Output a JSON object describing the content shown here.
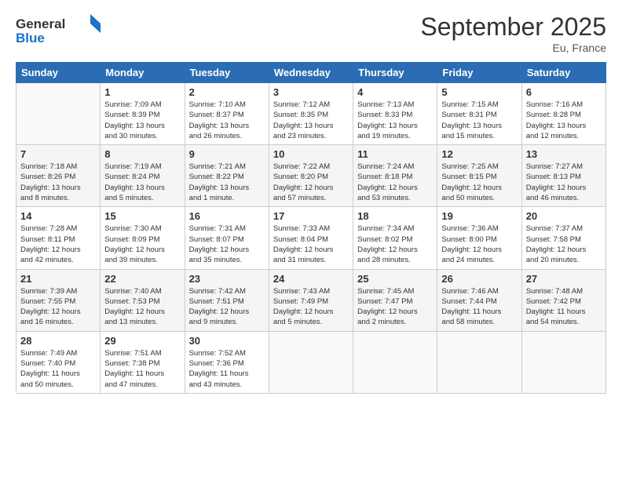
{
  "logo": {
    "general": "General",
    "blue": "Blue"
  },
  "header": {
    "month": "September 2025",
    "location": "Eu, France"
  },
  "weekdays": [
    "Sunday",
    "Monday",
    "Tuesday",
    "Wednesday",
    "Thursday",
    "Friday",
    "Saturday"
  ],
  "weeks": [
    [
      {
        "day": "",
        "info": ""
      },
      {
        "day": "1",
        "info": "Sunrise: 7:09 AM\nSunset: 8:39 PM\nDaylight: 13 hours\nand 30 minutes."
      },
      {
        "day": "2",
        "info": "Sunrise: 7:10 AM\nSunset: 8:37 PM\nDaylight: 13 hours\nand 26 minutes."
      },
      {
        "day": "3",
        "info": "Sunrise: 7:12 AM\nSunset: 8:35 PM\nDaylight: 13 hours\nand 23 minutes."
      },
      {
        "day": "4",
        "info": "Sunrise: 7:13 AM\nSunset: 8:33 PM\nDaylight: 13 hours\nand 19 minutes."
      },
      {
        "day": "5",
        "info": "Sunrise: 7:15 AM\nSunset: 8:31 PM\nDaylight: 13 hours\nand 15 minutes."
      },
      {
        "day": "6",
        "info": "Sunrise: 7:16 AM\nSunset: 8:28 PM\nDaylight: 13 hours\nand 12 minutes."
      }
    ],
    [
      {
        "day": "7",
        "info": "Sunrise: 7:18 AM\nSunset: 8:26 PM\nDaylight: 13 hours\nand 8 minutes."
      },
      {
        "day": "8",
        "info": "Sunrise: 7:19 AM\nSunset: 8:24 PM\nDaylight: 13 hours\nand 5 minutes."
      },
      {
        "day": "9",
        "info": "Sunrise: 7:21 AM\nSunset: 8:22 PM\nDaylight: 13 hours\nand 1 minute."
      },
      {
        "day": "10",
        "info": "Sunrise: 7:22 AM\nSunset: 8:20 PM\nDaylight: 12 hours\nand 57 minutes."
      },
      {
        "day": "11",
        "info": "Sunrise: 7:24 AM\nSunset: 8:18 PM\nDaylight: 12 hours\nand 53 minutes."
      },
      {
        "day": "12",
        "info": "Sunrise: 7:25 AM\nSunset: 8:15 PM\nDaylight: 12 hours\nand 50 minutes."
      },
      {
        "day": "13",
        "info": "Sunrise: 7:27 AM\nSunset: 8:13 PM\nDaylight: 12 hours\nand 46 minutes."
      }
    ],
    [
      {
        "day": "14",
        "info": "Sunrise: 7:28 AM\nSunset: 8:11 PM\nDaylight: 12 hours\nand 42 minutes."
      },
      {
        "day": "15",
        "info": "Sunrise: 7:30 AM\nSunset: 8:09 PM\nDaylight: 12 hours\nand 39 minutes."
      },
      {
        "day": "16",
        "info": "Sunrise: 7:31 AM\nSunset: 8:07 PM\nDaylight: 12 hours\nand 35 minutes."
      },
      {
        "day": "17",
        "info": "Sunrise: 7:33 AM\nSunset: 8:04 PM\nDaylight: 12 hours\nand 31 minutes."
      },
      {
        "day": "18",
        "info": "Sunrise: 7:34 AM\nSunset: 8:02 PM\nDaylight: 12 hours\nand 28 minutes."
      },
      {
        "day": "19",
        "info": "Sunrise: 7:36 AM\nSunset: 8:00 PM\nDaylight: 12 hours\nand 24 minutes."
      },
      {
        "day": "20",
        "info": "Sunrise: 7:37 AM\nSunset: 7:58 PM\nDaylight: 12 hours\nand 20 minutes."
      }
    ],
    [
      {
        "day": "21",
        "info": "Sunrise: 7:39 AM\nSunset: 7:55 PM\nDaylight: 12 hours\nand 16 minutes."
      },
      {
        "day": "22",
        "info": "Sunrise: 7:40 AM\nSunset: 7:53 PM\nDaylight: 12 hours\nand 13 minutes."
      },
      {
        "day": "23",
        "info": "Sunrise: 7:42 AM\nSunset: 7:51 PM\nDaylight: 12 hours\nand 9 minutes."
      },
      {
        "day": "24",
        "info": "Sunrise: 7:43 AM\nSunset: 7:49 PM\nDaylight: 12 hours\nand 5 minutes."
      },
      {
        "day": "25",
        "info": "Sunrise: 7:45 AM\nSunset: 7:47 PM\nDaylight: 12 hours\nand 2 minutes."
      },
      {
        "day": "26",
        "info": "Sunrise: 7:46 AM\nSunset: 7:44 PM\nDaylight: 11 hours\nand 58 minutes."
      },
      {
        "day": "27",
        "info": "Sunrise: 7:48 AM\nSunset: 7:42 PM\nDaylight: 11 hours\nand 54 minutes."
      }
    ],
    [
      {
        "day": "28",
        "info": "Sunrise: 7:49 AM\nSunset: 7:40 PM\nDaylight: 11 hours\nand 50 minutes."
      },
      {
        "day": "29",
        "info": "Sunrise: 7:51 AM\nSunset: 7:38 PM\nDaylight: 11 hours\nand 47 minutes."
      },
      {
        "day": "30",
        "info": "Sunrise: 7:52 AM\nSunset: 7:36 PM\nDaylight: 11 hours\nand 43 minutes."
      },
      {
        "day": "",
        "info": ""
      },
      {
        "day": "",
        "info": ""
      },
      {
        "day": "",
        "info": ""
      },
      {
        "day": "",
        "info": ""
      }
    ]
  ]
}
